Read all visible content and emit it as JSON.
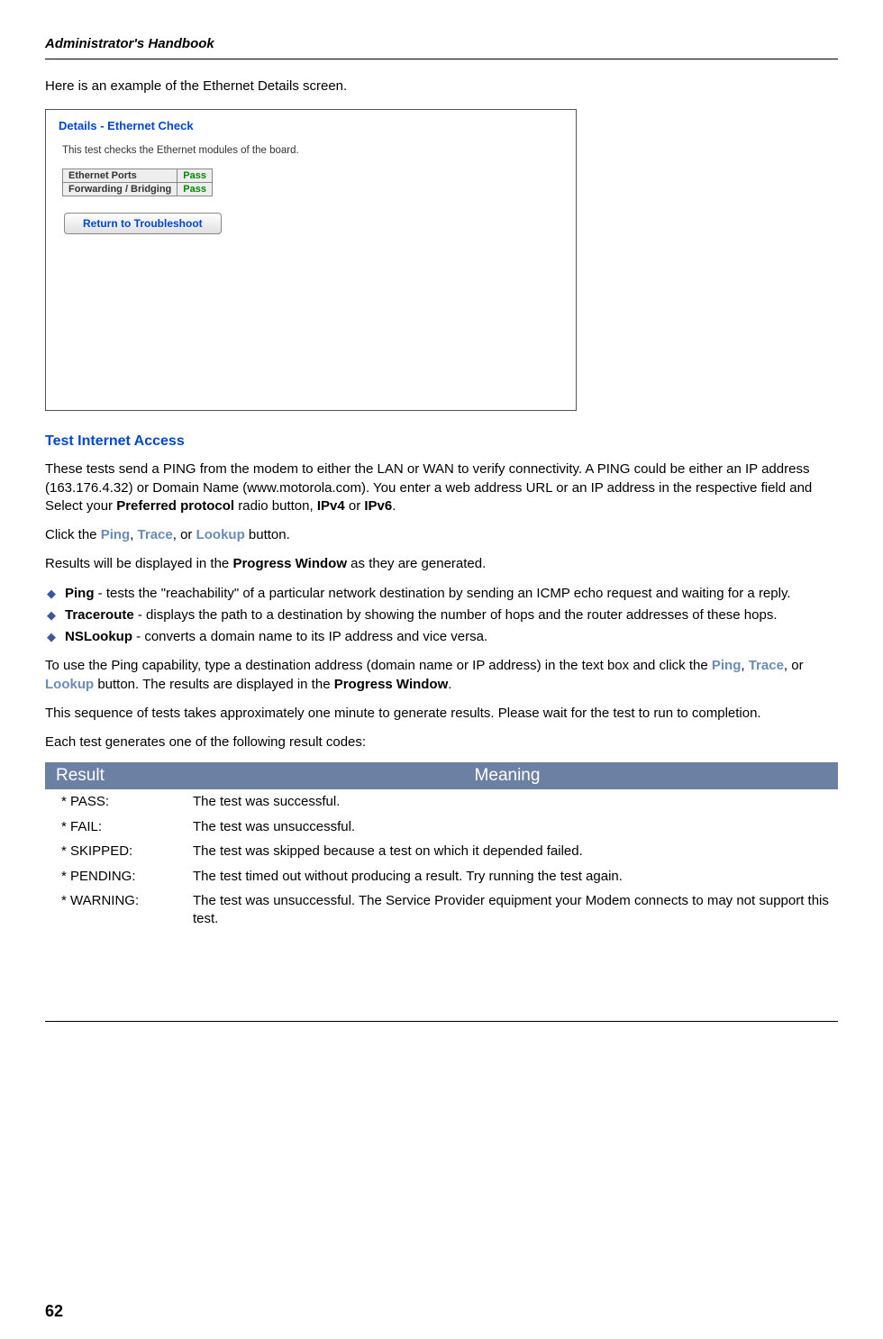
{
  "header": "Administrator's Handbook",
  "intro": "Here is an example of the Ethernet Details screen.",
  "screenshot": {
    "title": "Details - Ethernet Check",
    "desc": "This test checks the Ethernet modules of the board.",
    "rows": [
      {
        "label": "Ethernet Ports",
        "val": "Pass"
      },
      {
        "label": "Forwarding / Bridging",
        "val": "Pass"
      }
    ],
    "button": "Return to Troubleshoot"
  },
  "section": {
    "title": "Test Internet Access",
    "p1_a": " These tests send a PING from the modem to either the LAN or WAN to verify connectivity. A PING could be either an IP address (163.176.4.32) or Domain Name (www.motorola.com). You enter a web address URL or an IP address in the respective field and Select your ",
    "p1_b": "Preferred protocol",
    "p1_c": " radio button, ",
    "p1_d": "IPv4",
    "p1_e": " or ",
    "p1_f": "IPv6",
    "p1_g": ".",
    "p2_a": "Click the ",
    "p2_ping": "Ping",
    "p2_b": ", ",
    "p2_trace": "Trace",
    "p2_c": ", or ",
    "p2_lookup": "Lookup",
    "p2_d": " button.",
    "p3_a": "Results will be displayed in the ",
    "p3_b": "Progress Window",
    "p3_c": " as they are generated.",
    "bullets": [
      {
        "b": "Ping",
        "t": " - tests the \"reachability\" of a particular network destination by sending an ICMP echo request and waiting for a reply."
      },
      {
        "b": "Traceroute",
        "t": " - displays the path to a destination by showing the number of hops and the router addresses of these hops."
      },
      {
        "b": "NSLookup",
        "t": " - converts a domain name to its IP address and vice versa."
      }
    ],
    "p4_a": "To use the Ping capability, type a destination address (domain name or IP address) in the text box and click the ",
    "p4_b": " button. The results are displayed in the ",
    "p4_c": "Progress Window",
    "p4_d": ".",
    "p5": "This sequence of tests takes approximately one minute to generate results. Please wait for the test to run to completion.",
    "p6": "Each test generates one of the following result codes:"
  },
  "table": {
    "h1": "Result",
    "h2": "Meaning",
    "rows": [
      {
        "r": "* PASS:",
        "m": "The test was successful."
      },
      {
        "r": "* FAIL:",
        "m": "The test was unsuccessful."
      },
      {
        "r": "* SKIPPED:",
        "m": "The test was skipped because a test on which it depended failed."
      },
      {
        "r": "* PENDING:",
        "m": "The test timed out without producing a result. Try running the test again."
      },
      {
        "r": "* WARNING:",
        "m": "The test was unsuccessful. The Service Provider equipment your Modem connects to may not support this test."
      }
    ]
  },
  "pageNum": "62"
}
